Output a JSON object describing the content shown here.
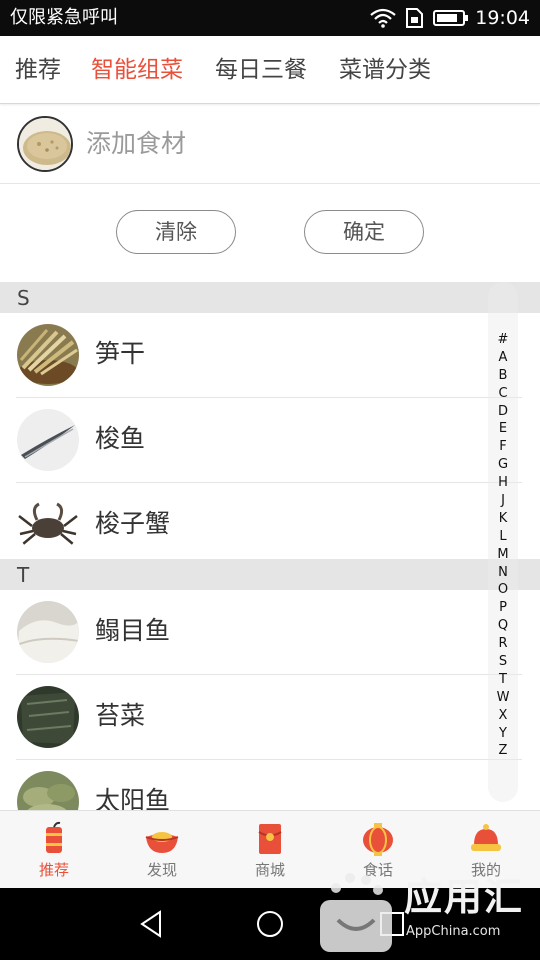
{
  "status_bar": {
    "carrier": "仅限紧急呼叫",
    "time": "19:04"
  },
  "top_tabs": [
    {
      "label": "推荐",
      "active": false
    },
    {
      "label": "智能组菜",
      "active": true
    },
    {
      "label": "每日三餐",
      "active": false
    },
    {
      "label": "菜谱分类",
      "active": false
    }
  ],
  "add_ingredient": {
    "placeholder": "添加食材"
  },
  "actions": {
    "clear_label": "清除",
    "confirm_label": "确定"
  },
  "sections": [
    {
      "letter": "S",
      "items": [
        "笋干",
        "梭鱼",
        "梭子蟹"
      ]
    },
    {
      "letter": "T",
      "items": [
        "鳎目鱼",
        "苔菜",
        "太阳鱼"
      ]
    }
  ],
  "index_letters": [
    "#",
    "A",
    "B",
    "C",
    "D",
    "E",
    "F",
    "G",
    "H",
    "J",
    "K",
    "L",
    "M",
    "N",
    "O",
    "P",
    "Q",
    "R",
    "S",
    "T",
    "W",
    "X",
    "Y",
    "Z"
  ],
  "bottom_nav": [
    {
      "label": "推荐",
      "icon": "firecracker-icon",
      "active": true
    },
    {
      "label": "发现",
      "icon": "gold-ingot-icon",
      "active": false
    },
    {
      "label": "商城",
      "icon": "red-envelope-icon",
      "active": false
    },
    {
      "label": "食话",
      "icon": "lantern-icon",
      "active": false
    },
    {
      "label": "我的",
      "icon": "hat-icon",
      "active": false
    }
  ],
  "watermark": {
    "brand": "应用汇",
    "url": "AppChina.com"
  },
  "colors": {
    "accent": "#e8503a",
    "status_bar": "#0c0c0c",
    "section_header": "#e5e5e5"
  }
}
